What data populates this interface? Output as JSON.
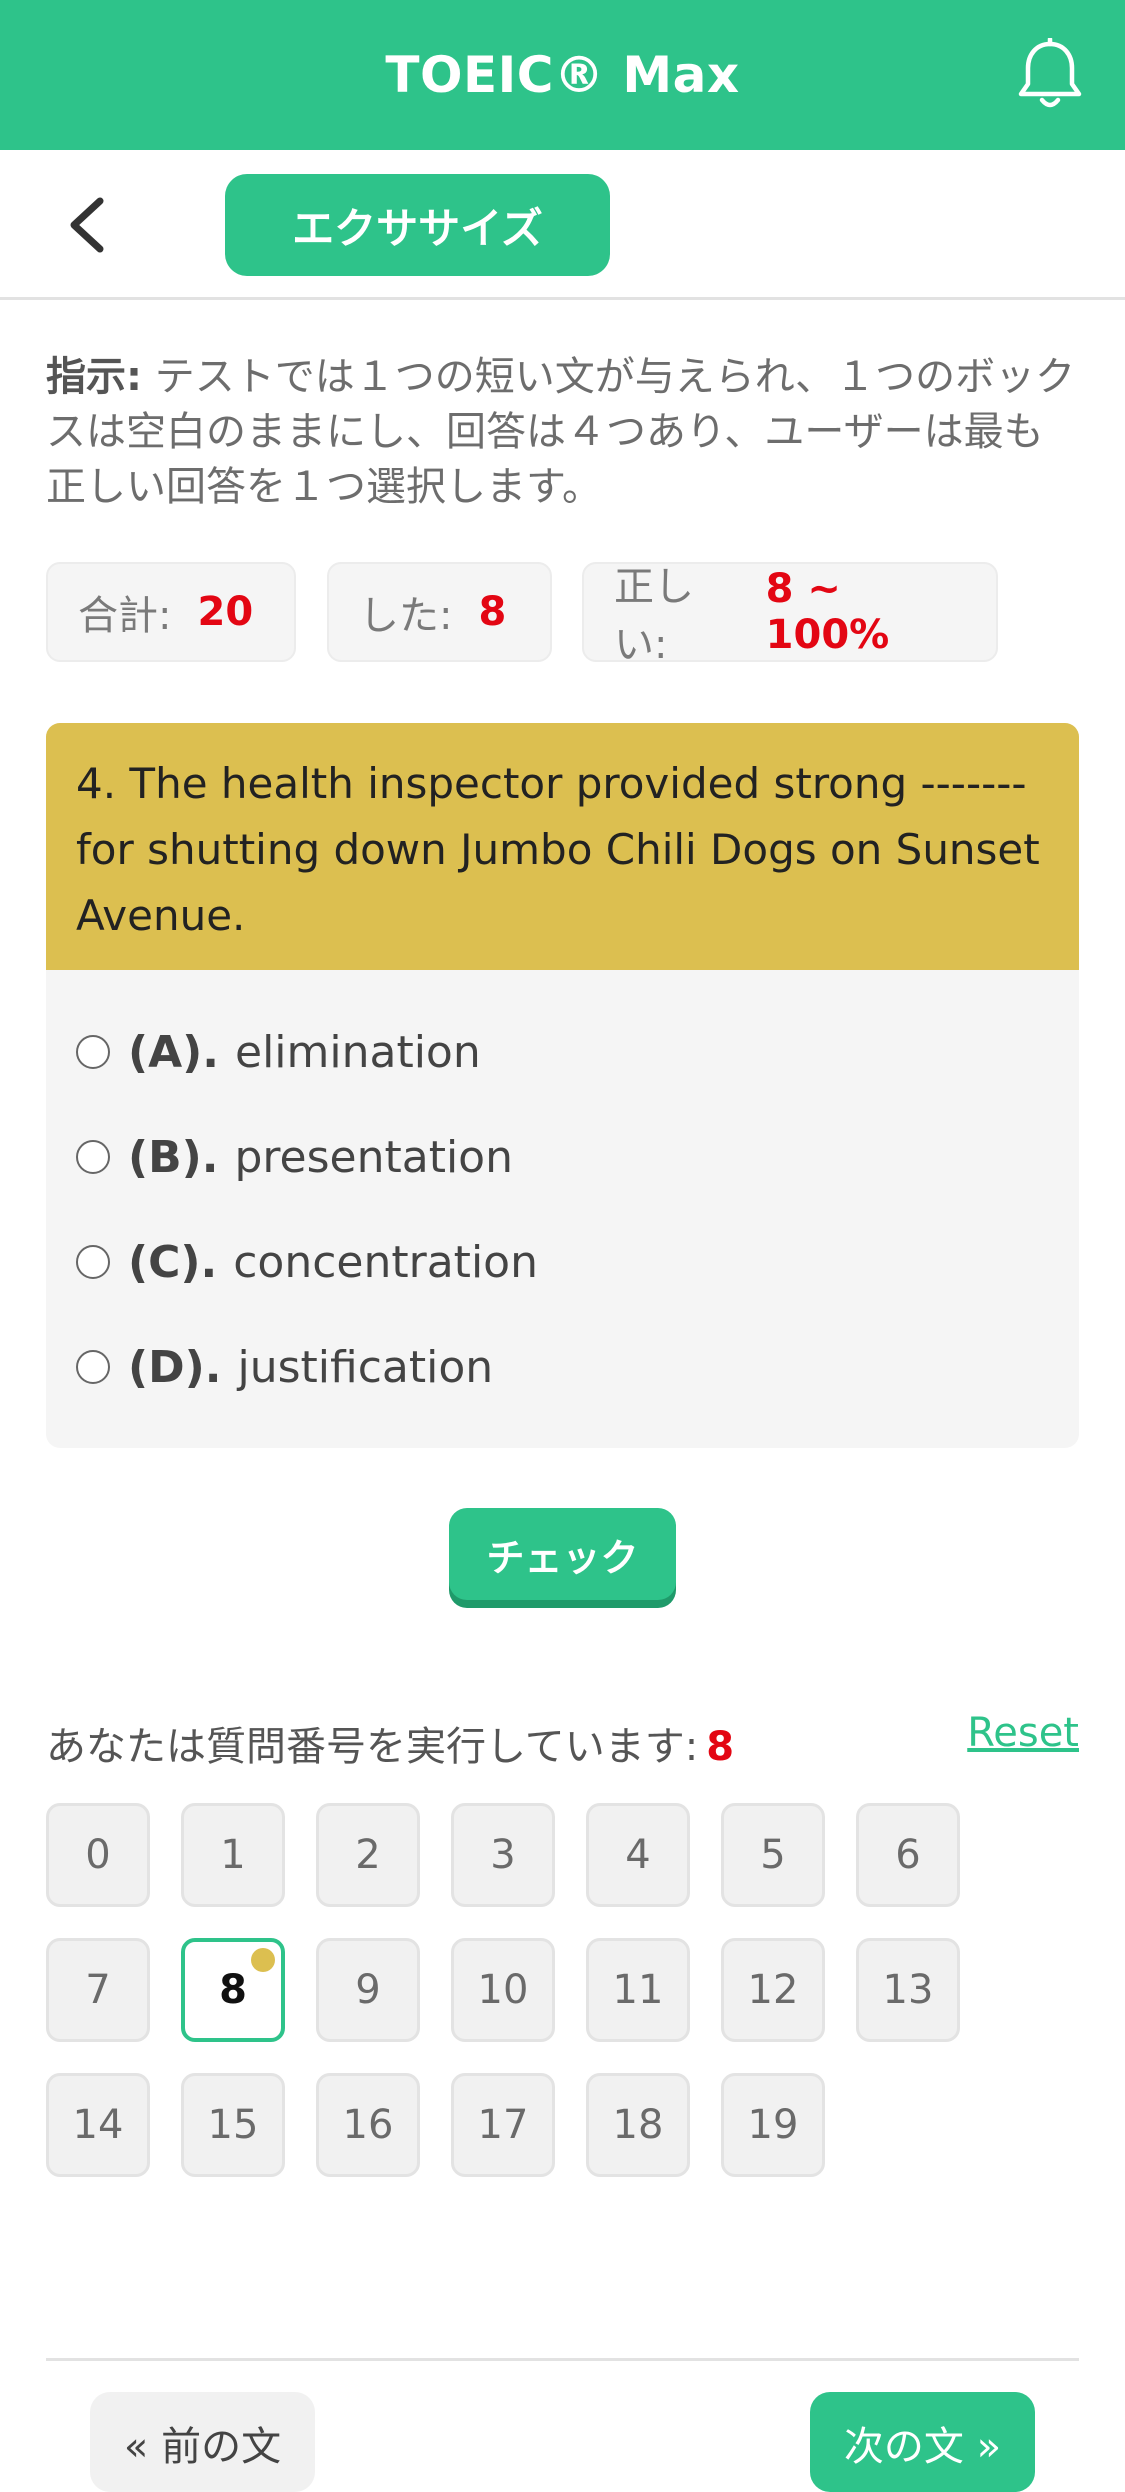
{
  "header": {
    "title": "TOEIC® Max"
  },
  "subbar": {
    "exercise_label": "エクササイズ"
  },
  "instruction": {
    "label": "指示:",
    "text": " テストでは１つの短い文が与えられ、１つのボックスは空白のままにし、回答は４つあり、ユーザーは最も正しい回答を１つ選択します。"
  },
  "stats": {
    "total_label": "合計:",
    "total_value": "20",
    "done_label": "した:",
    "done_value": "8",
    "correct_label": "正しい:",
    "correct_value": "8 ~ 100%"
  },
  "question": {
    "text": "4. The health inspector provided strong ------- for shutting down Jumbo Chili Dogs on Sunset Avenue.",
    "options": [
      {
        "letter": "(A).",
        "text": "elimination"
      },
      {
        "letter": "(B).",
        "text": "presentation"
      },
      {
        "letter": "(C).",
        "text": "concentration"
      },
      {
        "letter": "(D).",
        "text": "justification"
      }
    ]
  },
  "check_label": "チェック",
  "progress": {
    "label": "あなたは質問番号を実行しています:",
    "current": "8",
    "reset_label": "Reset"
  },
  "question_numbers": [
    "0",
    "1",
    "2",
    "3",
    "4",
    "5",
    "6",
    "7",
    "8",
    "9",
    "10",
    "11",
    "12",
    "13",
    "14",
    "15",
    "16",
    "17",
    "18",
    "19"
  ],
  "colors": {
    "primary": "#2ec38a",
    "question_header": "#dcbf50",
    "highlight": "#e30613"
  },
  "nav": {
    "prev_label": "« 前の文",
    "next_label": "次の文 »"
  }
}
